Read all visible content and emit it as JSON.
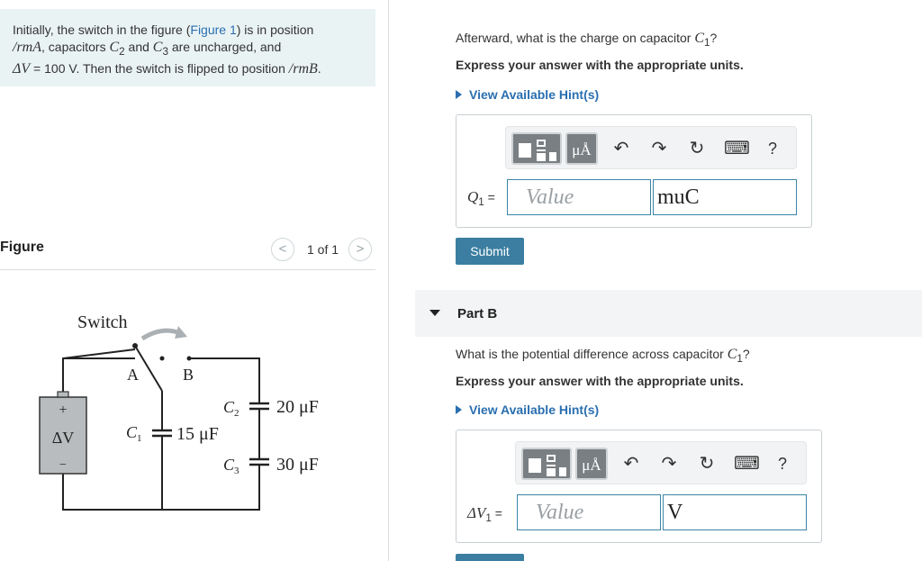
{
  "problem": {
    "text_1": "Initially, the switch in the figure (",
    "figure_link": "Figure 1",
    "text_2": ") is in position ",
    "pos_a": "/rmA",
    "text_3": ", capacitors ",
    "c2": "C",
    "c2_sub": "2",
    "text_4": " and ",
    "c3": "C",
    "c3_sub": "3",
    "text_5": " are uncharged, and ",
    "dv": "ΔV",
    "text_6": " = 100 ",
    "volt": "V",
    "text_7": ". Then the switch is flipped to position ",
    "pos_b": "/rmB",
    "text_8": "."
  },
  "figure": {
    "title": "Figure",
    "pager": "1 of 1",
    "prev": "<",
    "next": ">",
    "labels": {
      "switch": "Switch",
      "a": "A",
      "b": "B",
      "plus": "+",
      "minus": "−",
      "dv": "ΔV",
      "c1": "C",
      "c1_sub": "1",
      "c1_val": "15 μF",
      "c2": "C",
      "c2_sub": "2",
      "c2_val": "20 μF",
      "c3": "C",
      "c3_sub": "3",
      "c3_val": "30 μF"
    }
  },
  "partA": {
    "question_1": "Afterward, what is the charge on capacitor ",
    "var": "C",
    "var_sub": "1",
    "question_2": "?",
    "instruction": "Express your answer with the appropriate units.",
    "hint": "View Available Hint(s)",
    "eq_var": "Q",
    "eq_sub": "1",
    "eq_sign": " =",
    "value_placeholder": "Value",
    "unit_value": "muC",
    "submit": "Submit"
  },
  "partB": {
    "label": "Part B",
    "question_1": "What is the potential difference across capacitor ",
    "var": "C",
    "var_sub": "1",
    "question_2": "?",
    "instruction": "Express your answer with the appropriate units.",
    "hint": "View Available Hint(s)",
    "eq_var": "ΔV",
    "eq_sub": "1",
    "eq_sign": " =",
    "value_placeholder": "Value",
    "unit_value": "V"
  },
  "toolbar": {
    "unit_btn": "μÅ",
    "help": "?",
    "icons": [
      "templates-icon",
      "units-icon",
      "undo-icon",
      "redo-icon",
      "reset-icon",
      "keyboard-icon",
      "help-icon"
    ]
  },
  "colors": {
    "accent": "#3b7ea1",
    "link": "#2a6fb0",
    "problem_bg": "#eaf3f4",
    "battery": "#b9bcbe"
  }
}
